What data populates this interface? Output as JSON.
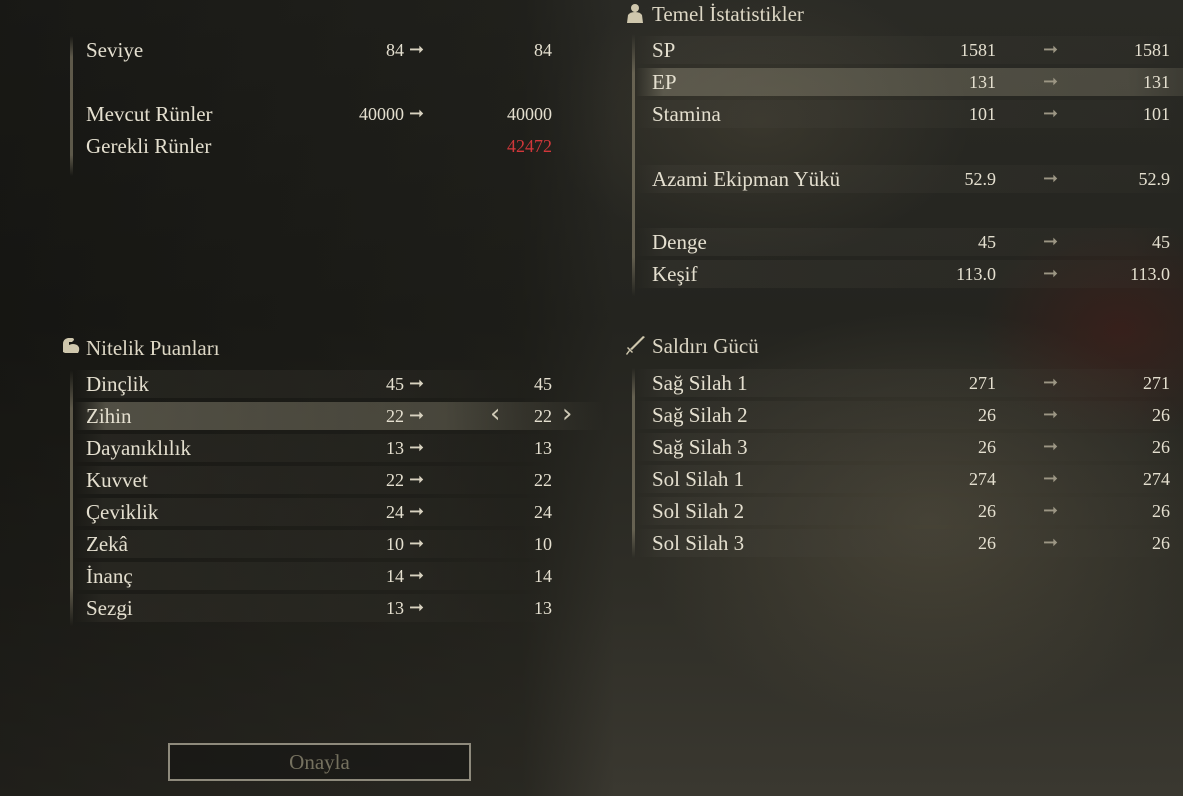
{
  "level_panel": {
    "level": {
      "label": "Seviye",
      "current": "84",
      "new": "84"
    },
    "held_runes": {
      "label": "Mevcut Rünler",
      "current": "40000",
      "new": "40000"
    },
    "required_runes": {
      "label": "Gerekli Rünler",
      "value": "42472",
      "color": "#d2373a"
    }
  },
  "attributes": {
    "title": "Nitelik Puanları",
    "icon": "flexed-arm-icon",
    "rows": [
      {
        "label": "Dinçlik",
        "current": "45",
        "new": "45"
      },
      {
        "label": "Zihin",
        "current": "22",
        "new": "22"
      },
      {
        "label": "Dayanıklılık",
        "current": "13",
        "new": "13"
      },
      {
        "label": "Kuvvet",
        "current": "22",
        "new": "22"
      },
      {
        "label": "Çeviklik",
        "current": "24",
        "new": "24"
      },
      {
        "label": "Zekâ",
        "current": "10",
        "new": "10"
      },
      {
        "label": "İnanç",
        "current": "14",
        "new": "14"
      },
      {
        "label": "Sezgi",
        "current": "13",
        "new": "13"
      }
    ],
    "selected_index": 1
  },
  "base_stats": {
    "title": "Temel İstatistikler",
    "icon": "person-bust-icon",
    "rows": [
      {
        "label": "SP",
        "current": "1581",
        "new": "1581"
      },
      {
        "label": "EP",
        "current": "131",
        "new": "131"
      },
      {
        "label": "Stamina",
        "current": "101",
        "new": "101"
      },
      {
        "label": "Azami Ekipman Yükü",
        "current": "52.9",
        "new": "52.9"
      },
      {
        "label": "Denge",
        "current": "45",
        "new": "45"
      },
      {
        "label": "Keşif",
        "current": "113.0",
        "new": "113.0"
      }
    ]
  },
  "attack_power": {
    "title": "Saldırı Gücü",
    "icon": "sword-icon",
    "rows": [
      {
        "label": "Sağ Silah 1",
        "current": "271",
        "new": "271"
      },
      {
        "label": "Sağ Silah 2",
        "current": "26",
        "new": "26"
      },
      {
        "label": "Sağ Silah 3",
        "current": "26",
        "new": "26"
      },
      {
        "label": "Sol Silah 1",
        "current": "274",
        "new": "274"
      },
      {
        "label": "Sol Silah 2",
        "current": "26",
        "new": "26"
      },
      {
        "label": "Sol Silah 3",
        "current": "26",
        "new": "26"
      }
    ]
  },
  "arrow_glyph": "➞",
  "chevron_left": "‹",
  "chevron_right": "›",
  "confirm_label": "Onayla",
  "colors": {
    "text": "#e4dfcf",
    "required_runes": "#d2373a",
    "confirm_disabled_text": "#75715f"
  }
}
